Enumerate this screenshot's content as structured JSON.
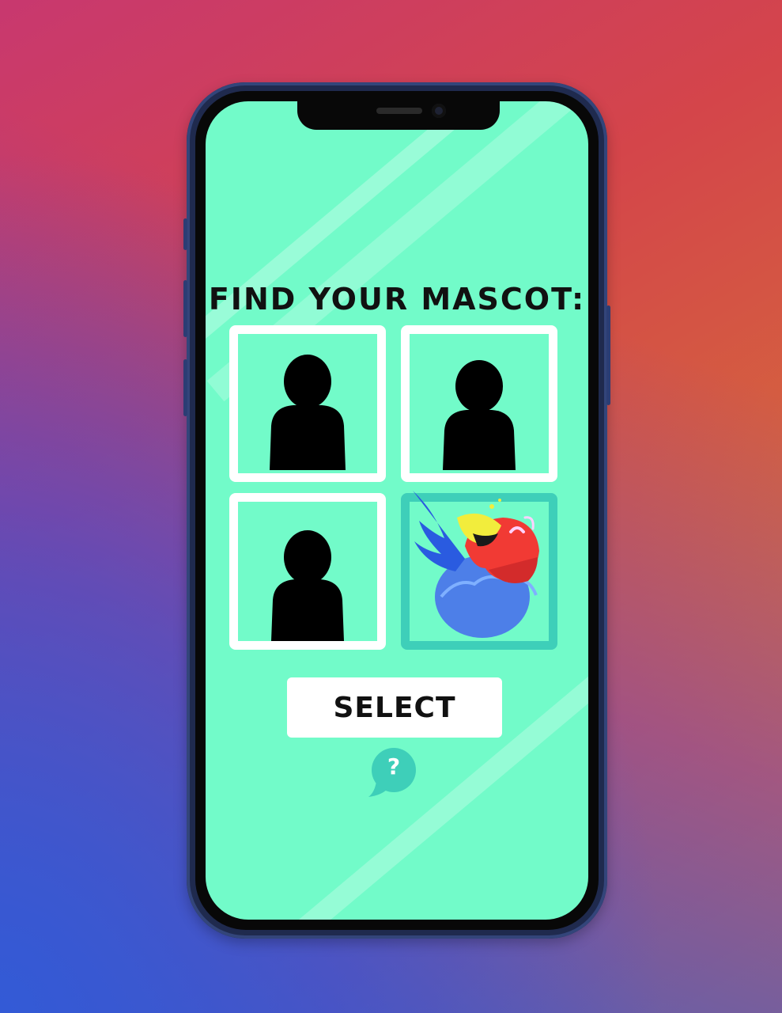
{
  "screen": {
    "title": "FIND YOUR MASCOT:",
    "select_label": "SELECT",
    "help_label": "?"
  },
  "mascots": [
    {
      "name": "mascot-1",
      "revealed": false,
      "icon": "person-silhouette-icon"
    },
    {
      "name": "mascot-2",
      "revealed": false,
      "icon": "person-silhouette-icon"
    },
    {
      "name": "mascot-3",
      "revealed": false,
      "icon": "person-silhouette-icon"
    },
    {
      "name": "mascot-4",
      "revealed": true,
      "icon": "parrot-icon",
      "selected": true
    }
  ],
  "colors": {
    "screen_bg": "#72fbc9",
    "card_border": "#ffffff",
    "selected_border": "#3ecfb9",
    "help_bubble": "#3ecfb9"
  }
}
